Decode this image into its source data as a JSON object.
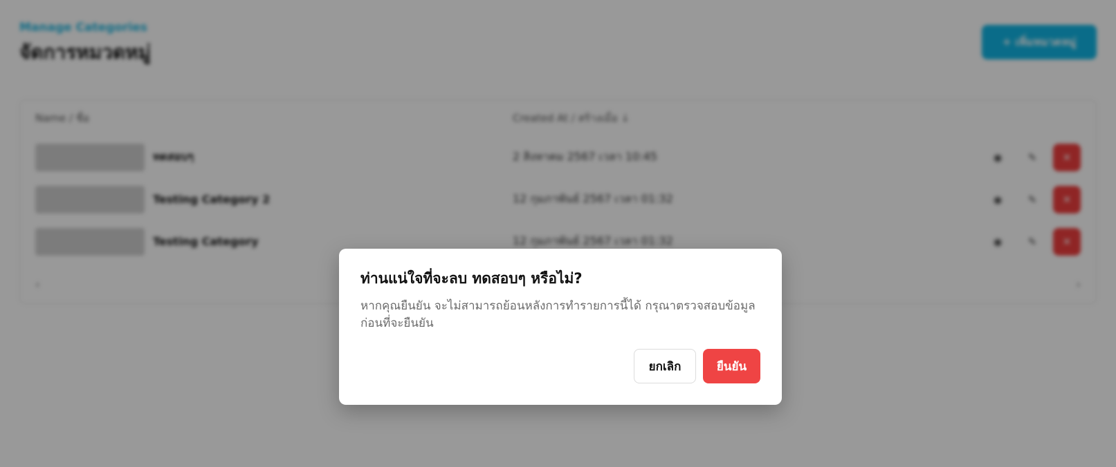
{
  "page": {
    "breadcrumb": "Manage Categories",
    "title": "จัดการหมวดหมู่",
    "add_button_label": "+ เพิ่มหมวดหมู่",
    "table": {
      "columns": [
        "Name / ชื่อ",
        "Created At / สร้างเมื่อ ↓"
      ],
      "rows": [
        {
          "name": "ทดสอบๆ",
          "created_at": "2 สิงหาคม 2567 เวลา 10:45"
        },
        {
          "name": "Testing Category 2",
          "created_at": "12 กุมภาพันธ์ 2567 เวลา 01:32"
        },
        {
          "name": "Testing Category",
          "created_at": "12 กุมภาพันธ์ 2567 เวลา 01:32"
        }
      ],
      "pager_prev": "‹",
      "pager_next": "›"
    }
  },
  "modal": {
    "title": "ท่านแน่ใจที่จะลบ ทดสอบๆ หรือไม่?",
    "description": "หากคุณยืนยัน จะไม่สามารถย้อนหลังการทำรายการนี้ได้ กรุณาตรวจสอบข้อมูลก่อนที่จะยืนยัน",
    "cancel_label": "ยกเลิก",
    "confirm_label": "ยืนยัน"
  },
  "colors": {
    "accent": "#11b5e4",
    "danger": "#ef4444",
    "overlay": "rgba(0,0,0,0.40)"
  }
}
